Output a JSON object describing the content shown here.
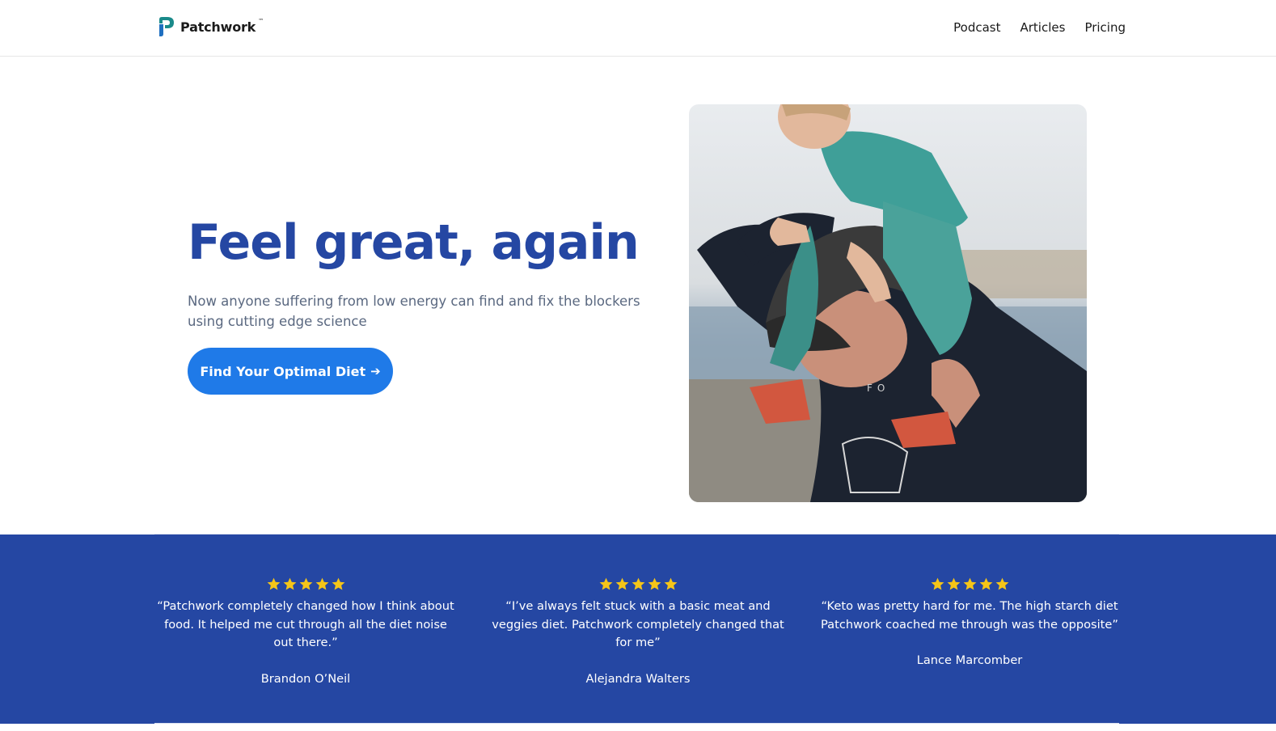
{
  "header": {
    "brand": "Patchwork",
    "brand_mark": "™",
    "nav": [
      {
        "label": "Podcast"
      },
      {
        "label": "Articles"
      },
      {
        "label": "Pricing"
      }
    ]
  },
  "hero": {
    "title": "Feel great, again",
    "subtitle": "Now anyone suffering from low energy can find and fix the blockers using cutting edge science",
    "cta_label": "Find Your Optimal Diet",
    "cta_icon": "arrow-right-icon",
    "image": "father-carrying-child-on-shoulders-photo"
  },
  "testimonials": [
    {
      "rating": 5,
      "quote": "“Patchwork completely changed how I think about food. It helped me cut through all the diet noise out there.”",
      "author": "Brandon O’Neil"
    },
    {
      "rating": 5,
      "quote": "“I’ve always felt stuck with a basic meat and veggies diet. Patchwork completely changed that for me”",
      "author": "Alejandra Walters"
    },
    {
      "rating": 5,
      "quote": "“Keto was pretty hard for me. The high starch diet Patchwork coached me through was the opposite”",
      "author": "Lance Marcomber"
    }
  ],
  "colors": {
    "brand_blue": "#2547a3",
    "cta_blue": "#1f7ae8",
    "logo_teal": "#1a8a8a",
    "star_yellow": "#f5c518"
  }
}
